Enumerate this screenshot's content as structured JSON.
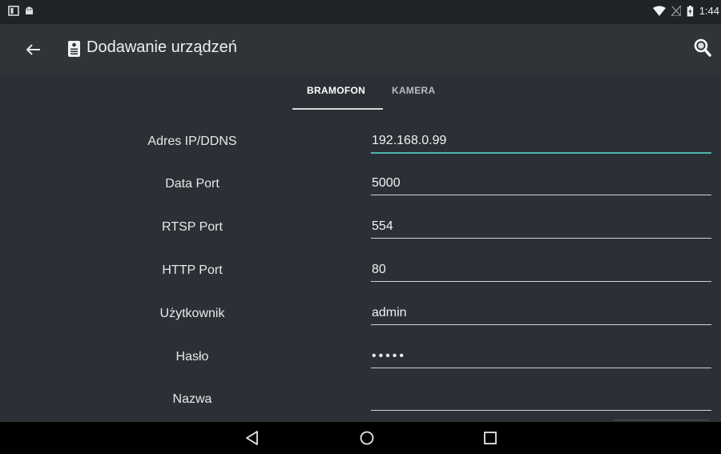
{
  "status_bar": {
    "time": "1:44"
  },
  "app_bar": {
    "title": "Dodawanie urządzeń"
  },
  "tabs": [
    {
      "label": "BRAMOFON",
      "active": true
    },
    {
      "label": "KAMERA",
      "active": false
    }
  ],
  "form": {
    "fields": [
      {
        "label": "Adres IP/DDNS",
        "value": "192.168.0.99"
      },
      {
        "label": "Data Port",
        "value": "5000"
      },
      {
        "label": "RTSP Port",
        "value": "554"
      },
      {
        "label": "HTTP Port",
        "value": "80"
      },
      {
        "label": "Użytkownik",
        "value": "admin"
      },
      {
        "label": "Hasło",
        "value": "•••••"
      },
      {
        "label": "Nazwa",
        "value": ""
      }
    ]
  },
  "colors": {
    "accent": "#4db6ac",
    "background": "#2b3036",
    "appbar": "#2f3439"
  },
  "icons": {
    "back": "arrow-left-icon",
    "app": "intercom-icon",
    "search": "search-icon",
    "nav_back": "triangle-back-icon",
    "nav_home": "circle-home-icon",
    "nav_recents": "square-recents-icon"
  }
}
